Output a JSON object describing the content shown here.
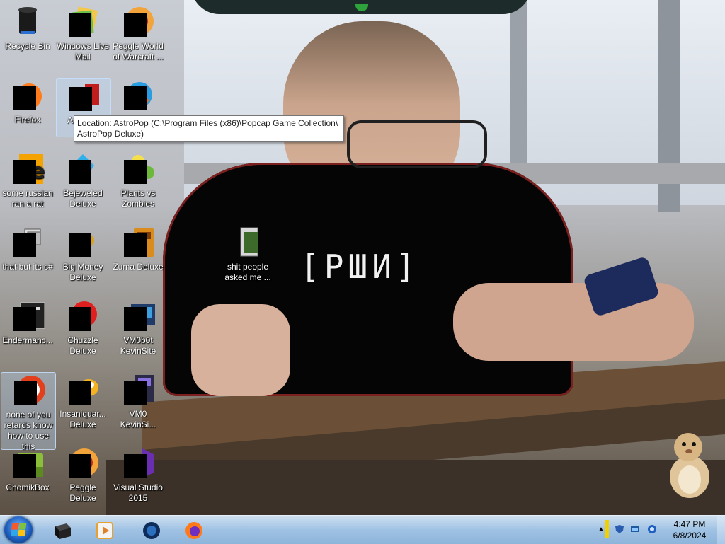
{
  "desktop": {
    "shirt_text": "[РШИ]",
    "icons": [
      {
        "id": "recycle-bin",
        "label": "Recycle Bin",
        "icon": "recycle-bin-icon"
      },
      {
        "id": "windows-live-mail",
        "label": "Windows Live Mail",
        "icon": "mail-icon"
      },
      {
        "id": "peggle-world",
        "label": "Peggle World of Warcraft ...",
        "icon": "peggle-icon"
      },
      {
        "id": "firefox",
        "label": "Firefox",
        "icon": "firefox-icon"
      },
      {
        "id": "astropop",
        "label": "As... D...",
        "icon": "astropop-icon"
      },
      {
        "id": "icon-r2c3",
        "label": "",
        "icon": "app-icon"
      },
      {
        "id": "some-russian",
        "label": "some russian ran a rat",
        "icon": "app-icon"
      },
      {
        "id": "bejeweled",
        "label": "Bejeweled Deluxe",
        "icon": "gem-icon"
      },
      {
        "id": "plants-vs-zombies",
        "label": "Plants vs Zombies",
        "icon": "plant-icon"
      },
      {
        "id": "that-but-its-c",
        "label": "that but its c#",
        "icon": "shortcut-icon"
      },
      {
        "id": "big-money",
        "label": "Big Money Deluxe",
        "icon": "money-icon"
      },
      {
        "id": "zuma",
        "label": "Zuma Deluxe",
        "icon": "zuma-icon"
      },
      {
        "id": "enderman",
        "label": "Endermanc...",
        "icon": "app-icon"
      },
      {
        "id": "chuzzle",
        "label": "Chuzzle Deluxe",
        "icon": "chuzzle-icon"
      },
      {
        "id": "vm0b0t",
        "label": "VM0b0t KevinSite",
        "icon": "app-icon"
      },
      {
        "id": "none-of-you",
        "label": "none of you retards know how to use this",
        "icon": "app-icon"
      },
      {
        "id": "insaniquarium",
        "label": "Insaniquar... Deluxe",
        "icon": "fish-icon"
      },
      {
        "id": "vm0-kevin",
        "label": "VM0 KevinSi...",
        "icon": "file-icon"
      },
      {
        "id": "chomikbox",
        "label": "ChomikBox",
        "icon": "box-icon"
      },
      {
        "id": "peggle-deluxe",
        "label": "Peggle Deluxe",
        "icon": "peggle-icon"
      },
      {
        "id": "visual-studio",
        "label": "Visual Studio 2015",
        "icon": "visual-studio-icon"
      },
      {
        "id": "shit-people",
        "label": "shit people asked me ...",
        "icon": "folder-icon"
      }
    ],
    "tooltip": "Location: AstroPop (C:\\Program Files (x86)\\Popcap Game Collection\\ AstroPop Deluxe)"
  },
  "taskbar": {
    "pinned": [
      {
        "name": "app",
        "icon": "dark-box-icon"
      },
      {
        "name": "media-player",
        "icon": "media-player-icon"
      },
      {
        "name": "app2",
        "icon": "globe-icon"
      },
      {
        "name": "firefox",
        "icon": "firefox-icon"
      }
    ],
    "clock_time": "4:47 PM",
    "clock_date": "6/8/2024"
  },
  "colors": {
    "taskbar": "#9fc2e4",
    "tooltip_bg": "#ffffff",
    "start_orb": "#1e5fbf"
  }
}
